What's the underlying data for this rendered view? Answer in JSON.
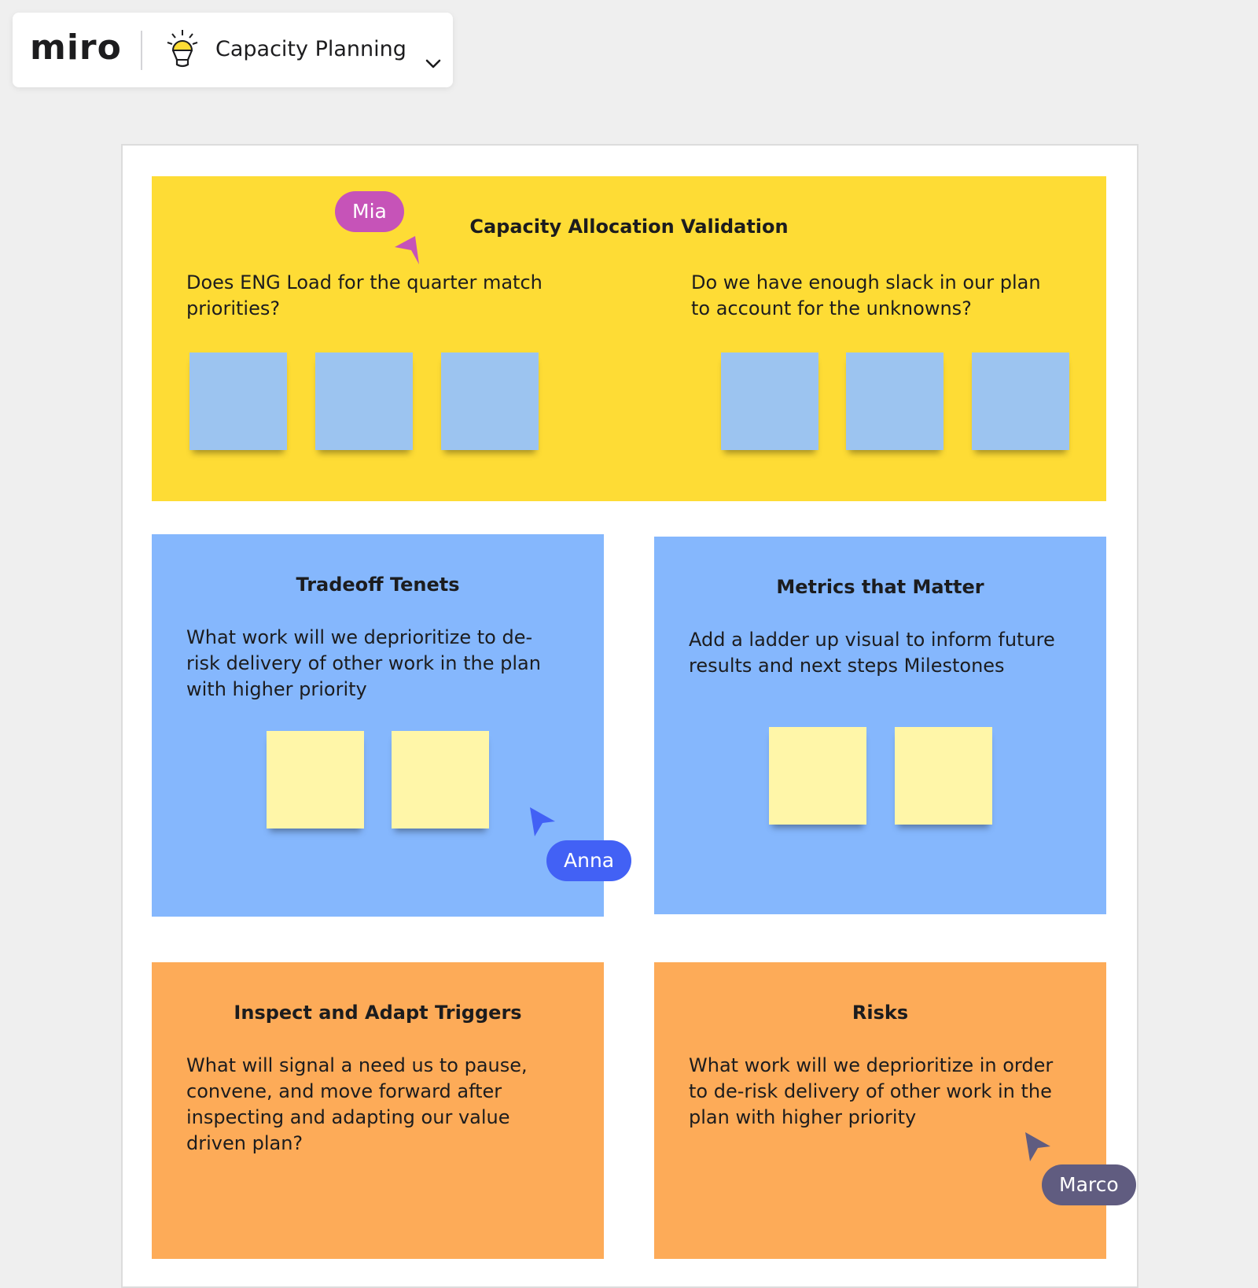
{
  "header": {
    "logo": "miro",
    "board_icon": "lightbulb-icon",
    "board_title": "Capacity Planning",
    "dropdown_icon": "chevron-down-icon"
  },
  "colors": {
    "canvas": "#efefef",
    "yellow_section": "#fedc35",
    "blue_section": "#85b7fd",
    "orange_section": "#fdab58",
    "sticky_blue": "#9cc4f0",
    "sticky_yellow": "#fff6a8",
    "cursor_mia": "#c653b8",
    "cursor_anna": "#4261f5",
    "cursor_marco": "#605c80"
  },
  "sections": {
    "capacity": {
      "title": "Capacity Allocation Validation",
      "left_question": "Does ENG Load for the quarter match priorities?",
      "right_question": "Do we have enough slack in our plan to account for the unknowns?",
      "left_stickies": [
        "",
        "",
        ""
      ],
      "right_stickies": [
        "",
        "",
        ""
      ]
    },
    "tradeoff": {
      "title": "Tradeoff Tenets",
      "body": "What work will we deprioritize to de-risk delivery of other work in the plan with higher priority",
      "stickies": [
        "",
        ""
      ]
    },
    "metrics": {
      "title": "Metrics that Matter",
      "body": "Add a ladder up visual to inform future results and next steps Milestones",
      "stickies": [
        "",
        ""
      ]
    },
    "inspect": {
      "title": "Inspect and Adapt Triggers",
      "body": "What will signal a need us to pause, convene, and move forward after inspecting and adapting our value driven plan?"
    },
    "risks": {
      "title": "Risks",
      "body": "What work will we deprioritize in order to de-risk delivery of other work in the plan with higher priority"
    }
  },
  "collaborators": [
    {
      "name": "Mia"
    },
    {
      "name": "Anna"
    },
    {
      "name": "Marco"
    }
  ]
}
